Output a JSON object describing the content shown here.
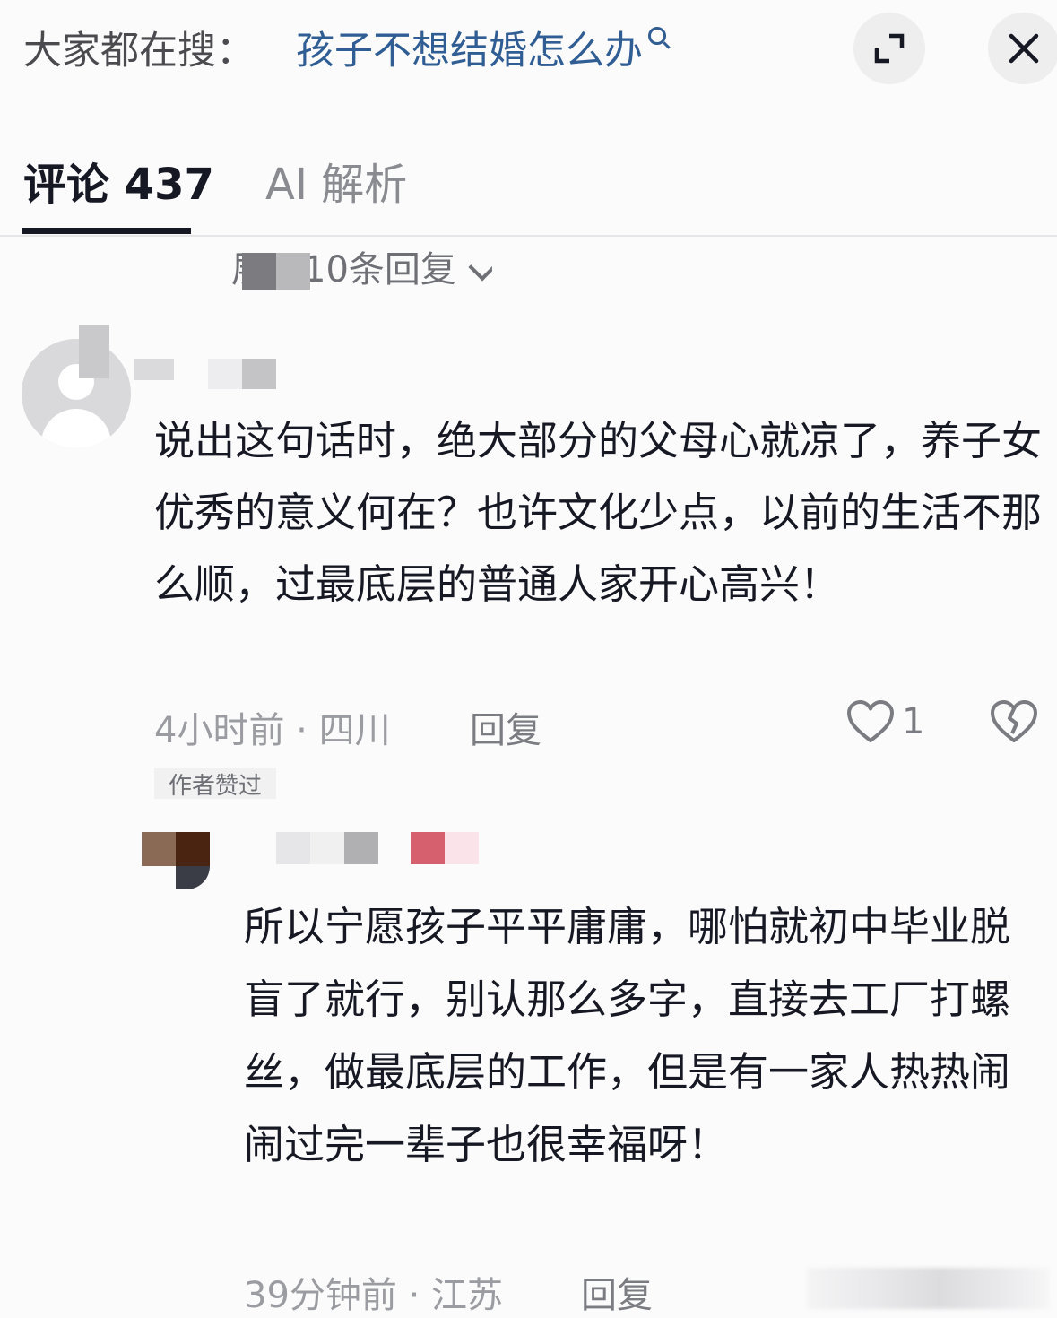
{
  "search": {
    "prefix": "大家都在搜：",
    "query": "孩子不想结婚怎么办",
    "icons": [
      "search-icon",
      "expand-icon",
      "close-icon"
    ]
  },
  "tabs": [
    {
      "label": "评论 437",
      "active": true
    },
    {
      "label": "AI 解析",
      "active": false
    }
  ],
  "expand_replies": {
    "label": "展开10条回复"
  },
  "comments": [
    {
      "text": "说出这句话时，绝大部分的父母心就凉了，养子女优秀的意义何在？也许文化少点，以前的生活不那么顺，过最底层的普通人家开心高兴！",
      "meta": "4小时前 · 四川",
      "reply_label": "回复",
      "like_count": "1",
      "badge": "作者赞过"
    },
    {
      "text": "所以宁愿孩子平平庸庸，哪怕就初中毕业脱盲了就行，别认那么多字，直接去工厂打螺丝，做最底层的工作，但是有一家人热热闹闹过完一辈子也很幸福呀！",
      "meta": "39分钟前 · 江苏",
      "reply_label": "回复"
    }
  ],
  "colors": {
    "link": "#2f5d94",
    "text": "#161823",
    "muted": "#9b9ca1"
  }
}
